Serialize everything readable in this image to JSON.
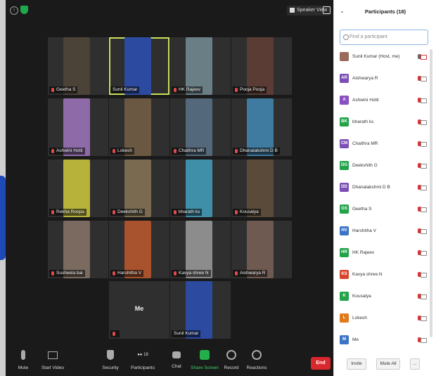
{
  "window": {
    "speaker_view_label": "Speaker View",
    "security_color": "#1fa94a"
  },
  "gallery": {
    "tiles": [
      {
        "name": "Geetha S",
        "muted": true,
        "bg": "#4b4238"
      },
      {
        "name": "Sunil Kumar",
        "muted": false,
        "active": true,
        "bg": "#2c4aa0"
      },
      {
        "name": "HK Rajeev",
        "muted": true,
        "bg": "#6a7e86"
      },
      {
        "name": "Pooja Pooja",
        "muted": true,
        "bg": "#5a3c34"
      },
      {
        "name": "Ashwini Hotti",
        "muted": true,
        "bg": "#8f6aa8"
      },
      {
        "name": "Lokesh",
        "muted": true,
        "bg": "#6b5843"
      },
      {
        "name": "Chaithra MR",
        "muted": true,
        "bg": "#53687a"
      },
      {
        "name": "Dhanalakshmi D B",
        "muted": true,
        "bg": "#3f7aa0"
      },
      {
        "name": "Rekha Roopa",
        "muted": true,
        "bg": "#b6b23a"
      },
      {
        "name": "Deekshith G",
        "muted": true,
        "bg": "#7a6a50"
      },
      {
        "name": "bharath ks",
        "muted": true,
        "bg": "#3f8fa8"
      },
      {
        "name": "Kousalya",
        "muted": true,
        "bg": "#5a4a3a"
      },
      {
        "name": "Susheela bai",
        "muted": true,
        "bg": "#7a6a60"
      },
      {
        "name": "Harshitha V",
        "muted": true,
        "bg": "#a8522e"
      },
      {
        "name": "Kavya shree N",
        "muted": true,
        "bg": "#8c8c8c"
      },
      {
        "name": "Aishwarya R",
        "muted": true,
        "bg": "#6e5a50"
      },
      {
        "name": "Me",
        "muted": true,
        "bg": "#2f2f2f",
        "me": true
      },
      {
        "name": "Sunil Kumar",
        "muted": false,
        "bg": "#2c4aa0"
      }
    ],
    "me_label": "Me"
  },
  "toolbar": {
    "mute": "Mute",
    "start_video": "Start Video",
    "security": "Security",
    "participants": "Participants",
    "participants_count": "18",
    "chat": "Chat",
    "share_screen": "Share Screen",
    "record": "Record",
    "reactions": "Reactions",
    "end": "End"
  },
  "panel": {
    "title": "Participants (18)",
    "search_placeholder": "Find a participant",
    "invite": "Invite",
    "mute_all": "Mute All",
    "more": "...",
    "participants": [
      {
        "initials": "",
        "name": "Sunil Kumar (Host, me)",
        "color": "#9a6a5a",
        "mic_on": true
      },
      {
        "initials": "AR",
        "name": "Aishwarya R",
        "color": "#7b4fb5"
      },
      {
        "initials": "A",
        "name": "Ashwini Hotti",
        "color": "#8a4fc0"
      },
      {
        "initials": "BK",
        "name": "bharath ks",
        "color": "#22a34a"
      },
      {
        "initials": "CM",
        "name": "Chaithra MR",
        "color": "#7b4fb5"
      },
      {
        "initials": "DG",
        "name": "Deekshith G",
        "color": "#22a34a"
      },
      {
        "initials": "DD",
        "name": "Dhanalakshmi D B",
        "color": "#7b4fb5"
      },
      {
        "initials": "GS",
        "name": "Geetha S",
        "color": "#22a34a"
      },
      {
        "initials": "HV",
        "name": "Harshitha V",
        "color": "#3b73c9"
      },
      {
        "initials": "HR",
        "name": "HK Rajeev",
        "color": "#22a34a"
      },
      {
        "initials": "KS",
        "name": "Kavya shree.N",
        "color": "#d9462e"
      },
      {
        "initials": "K",
        "name": "Kousalya",
        "color": "#22a34a"
      },
      {
        "initials": "L",
        "name": "Lokesh",
        "color": "#e07a1f"
      },
      {
        "initials": "M",
        "name": "Me",
        "color": "#3b73c9"
      }
    ]
  }
}
